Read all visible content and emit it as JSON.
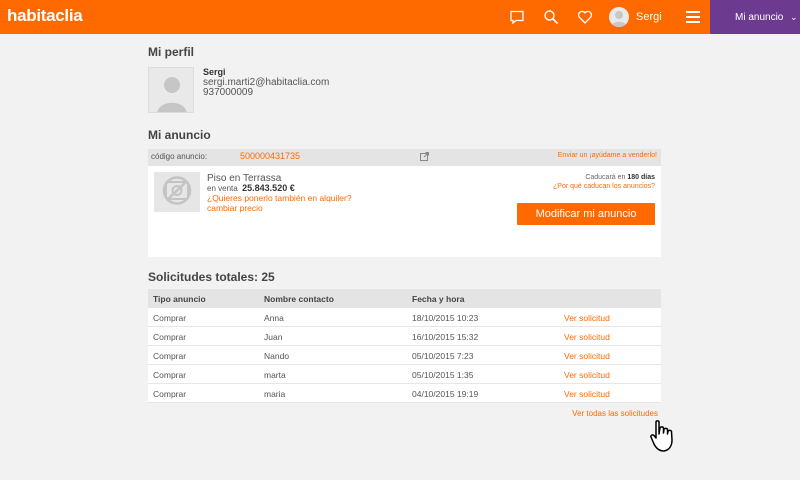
{
  "header": {
    "logo": "habitaclia",
    "user_name": "Sergi",
    "my_ad_label": "Mi anuncio",
    "icons": [
      "chat-icon",
      "search-icon",
      "heart-icon",
      "avatar",
      "hamburger-menu-icon",
      "chevron-down-icon"
    ],
    "brand_color": "#ff6a00",
    "secondary_color": "#6c3b8f"
  },
  "profile": {
    "section_title": "Mi perfil",
    "name": "Sergi",
    "email": "sergi.marti2@habitaclia.com",
    "phone": "937000009"
  },
  "ad": {
    "section_title": "Mi anuncio",
    "code_label": "código anuncio:",
    "code_value": "500000431735",
    "help_link": "Enviar un ¡ayúdame a venderlo!",
    "title": "Piso en Terrassa",
    "sale_prefix": "en venta",
    "price": "25.843.520 €",
    "rent_link": "¿Quieres ponerlo también en alquiler?",
    "price_link": "cambiar precio",
    "expire_prefix": "Caducará en",
    "expire_days": "180 días",
    "why_expire": "¿Por qué caducan los anuncios?",
    "modify_button": "Modificar mi anuncio"
  },
  "requests": {
    "title_label": "Solicitudes totales:",
    "total": "25",
    "columns": [
      "Tipo anuncio",
      "Nombre contacto",
      "Fecha y hora",
      ""
    ],
    "rows": [
      {
        "type": "Comprar",
        "contact": "Anna",
        "date": "18/10/2015 10:23",
        "action": "Ver solicitud"
      },
      {
        "type": "Comprar",
        "contact": "Juan",
        "date": "16/10/2015 15:32",
        "action": "Ver solicitud"
      },
      {
        "type": "Comprar",
        "contact": "Nando",
        "date": "05/10/2015 7:23",
        "action": "Ver solicitud"
      },
      {
        "type": "Comprar",
        "contact": "marta",
        "date": "05/10/2015 1:35",
        "action": "Ver solicitud"
      },
      {
        "type": "Comprar",
        "contact": "maria",
        "date": "04/10/2015 19:19",
        "action": "Ver solicitud"
      }
    ],
    "see_all": "Ver todas las solicitudes"
  }
}
